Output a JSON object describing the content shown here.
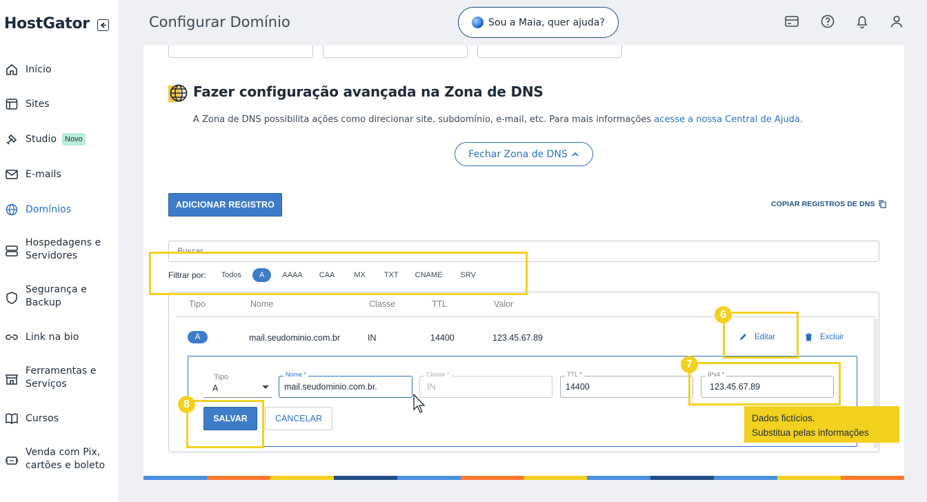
{
  "sidebar": {
    "logo": "HostGator",
    "items": [
      {
        "label": "Início",
        "icon": "home-icon"
      },
      {
        "label": "Sites",
        "icon": "layout-icon"
      },
      {
        "label": "Studio",
        "icon": "tools-icon",
        "badge": "Novo"
      },
      {
        "label": "E-mails",
        "icon": "mail-icon"
      },
      {
        "label": "Domínios",
        "icon": "globe-icon",
        "active": true
      },
      {
        "label_line1": "Hospedagens e",
        "label_line2": "Servidores",
        "icon": "server-icon"
      },
      {
        "label_line1": "Segurança e",
        "label_line2": "Backup",
        "icon": "shield-icon"
      },
      {
        "label": "Link na bio",
        "icon": "link-icon"
      },
      {
        "label_line1": "Ferramentas e",
        "label_line2": "Serviços",
        "icon": "store-icon"
      },
      {
        "label": "Cursos",
        "icon": "book-icon"
      },
      {
        "label_line1": "Venda com Pix,",
        "label_line2": "cartões e boleto",
        "icon": "payment-icon"
      }
    ]
  },
  "header": {
    "title": "Configurar Domínio",
    "assistant_label": "Sou a Maia, quer ajuda?",
    "icons": [
      "card-icon",
      "help-icon",
      "bell-icon",
      "user-icon"
    ]
  },
  "dns": {
    "title": "Fazer configuração avançada na Zona de DNS",
    "description": "A Zona de DNS possibilita ações como direcionar site, subdomínio, e-mail, etc. Para mais informações ",
    "help_link": "acesse a nossa Central de Ajuda",
    "description_end": ".",
    "close_label": "Fechar Zona de DNS",
    "add_label": "ADICIONAR REGISTRO",
    "copy_label": "COPIAR REGISTROS DE DNS",
    "search_placeholder": "Buscar",
    "filter_label": "Filtrar por:",
    "filters": [
      "Todos",
      "A",
      "AAAA",
      "CAA",
      "MX",
      "TXT",
      "CNAME",
      "SRV"
    ],
    "active_filter": "A",
    "columns": [
      "Tipo",
      "Nome",
      "Classe",
      "TTL",
      "Valor"
    ],
    "row": {
      "tipo": "A",
      "nome": "mail.seudominio.com.br",
      "classe": "IN",
      "ttl": "14400",
      "valor": "123.45.67.89",
      "edit": "Editar",
      "delete": "Excluir"
    },
    "edit_form": {
      "tipo_label": "Tipo",
      "tipo_value": "A",
      "nome_label": "Nome *",
      "nome_value": "mail.seudominio.com.br.",
      "classe_label": "Classe *",
      "classe_value": "IN",
      "ttl_label": "TTL *",
      "ttl_value": "14400",
      "ipv4_label": "IPv4 *",
      "ipv4_value": "123.45.67.89",
      "save": "SALVAR",
      "cancel": "CANCELAR"
    }
  },
  "annotations": {
    "step6": "6",
    "step7": "7",
    "step8": "8",
    "callout_line1": "Dados fictícios.",
    "callout_line2": "Substitua pelas informações"
  },
  "colors": {
    "accent": "#3d7cc9",
    "highlight": "#f2d11f",
    "text": "#1d2b3a"
  }
}
